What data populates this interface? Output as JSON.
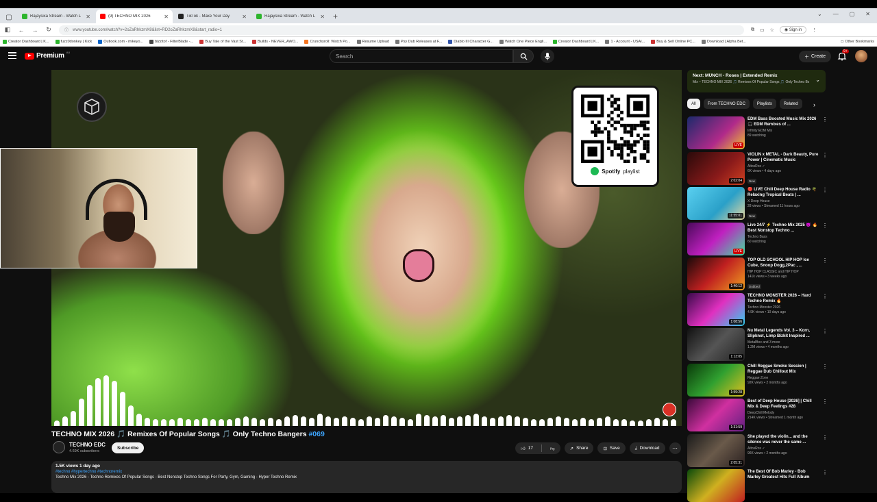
{
  "browser": {
    "tabs": [
      {
        "title": "Rajaysixa Stream - Watch L",
        "color": "#2db52d",
        "active": false
      },
      {
        "title": "(9) TECHNO MIX 2026",
        "color": "#ff0000",
        "active": true
      },
      {
        "title": "TikTok - Make Your Day",
        "color": "#222222",
        "active": false
      },
      {
        "title": "Rajaysixa Stream - Watch L",
        "color": "#2db52d",
        "active": false
      }
    ],
    "url": "www.youtube.com/watch?v=2oZaRhkzmX8&list=RD2oZaRhkzmX8&start_radio=1",
    "signin_label": "Sign in",
    "bookmarks": [
      {
        "label": "Creator Dashboard | K...",
        "color": "#2db52d"
      },
      {
        "label": "fuzz0donkey | Kick",
        "color": "#2db52d"
      },
      {
        "label": "Outlook.com - mikeyo...",
        "color": "#0a64c8"
      },
      {
        "label": "bizzitof - FilterBlade -...",
        "color": "#444444"
      },
      {
        "label": "Buy Tale of the Vast St...",
        "color": "#cc3333"
      },
      {
        "label": "Builds - NEVER_AWO...",
        "color": "#cc3333"
      },
      {
        "label": "Crunchyroll: Watch Po...",
        "color": "#f47521"
      },
      {
        "label": "Resume Upload",
        "color": "#777777"
      },
      {
        "label": "Psy Dub Releases at F...",
        "color": "#777777"
      },
      {
        "label": "Diablo III Character G...",
        "color": "#3355aa"
      },
      {
        "label": "Watch One Piece Engli...",
        "color": "#777777"
      },
      {
        "label": "Creator Dashboard | K...",
        "color": "#2db52d"
      },
      {
        "label": "1 - Account - USAI...",
        "color": "#777777"
      },
      {
        "label": "Buy & Sell Online PC...",
        "color": "#cc3333"
      },
      {
        "label": "Download | Alpha Bet...",
        "color": "#777777"
      }
    ],
    "bookmarks_other": "Other Bookmarks"
  },
  "youtube": {
    "logo_text": "Premium",
    "logo_country": "AU",
    "search_placeholder": "Search",
    "create_label": "Create",
    "notif_count": "9+",
    "video": {
      "qr_label": "playlist",
      "spotify_label": "Spotify"
    },
    "title_main": "TECHNO MIX 2026 🎵 Remixes Of Popular Songs 🎵 Only Techno Bangers ",
    "title_tag": "#069",
    "channel_name": "TECHNO EDC",
    "channel_subs": "4.69K subscribers",
    "subscribe_label": "Subscribe",
    "like_count": "17",
    "share_label": "Share",
    "save_label": "Save",
    "download_label": "Download",
    "desc_meta": "1.5K views  1 day ago",
    "desc_tags": "#techno #hypertechno #technoremix",
    "desc_text": "Techno Mix 2026 - Techno Remixes Of Popular Songs - Best Nonstop Techno Songs For Party, Gym, Gaming - Hyper Techno Remix",
    "next_title": "Next: MÜNCH - Roses | Extended Remix",
    "next_sub": "Mix – TECHNO MIX 2026 🎵 Remixes Of Popular Songs 🎵 Only Techno Bangers #069",
    "chips": [
      "All",
      "From TECHNO EDC",
      "Playlists",
      "Related"
    ],
    "recommendations": [
      {
        "title": "EDM Bass Boosted Music Mix 2026 🎧 EDM Remixes of ...",
        "channel": "Infinity EDM Mix",
        "meta": "89 watching",
        "badge": "",
        "duration": "LIVE",
        "live": true,
        "thumb": "linear-gradient(135deg,#1b2a6b,#b02a8a 60%,#f0c030)"
      },
      {
        "title": "VIOLIN x METAL - Dark Beauty, Pure Power | Cinematic Music",
        "channel": "AltosRox ✓",
        "meta": "6K views • 4 days ago",
        "badge": "New",
        "duration": "2:02:04",
        "live": false,
        "thumb": "linear-gradient(135deg,#2a0a0a,#8a1a1a 60%,#d04020)"
      },
      {
        "title": "🔴 LIVE Chill Deep House Radio 🌴 Relaxing Tropical Beats | ...",
        "channel": "X Deep House",
        "meta": "28 views • Streamed 11 hours ago",
        "badge": "New",
        "duration": "11:55:01",
        "live": false,
        "thumb": "linear-gradient(135deg,#5ad0f0,#2aa0c8 60%,#e8d8a0)"
      },
      {
        "title": "Live 24/7 ⚡ Techno Mix 2025 😈 🔥 Best Nonstop Techno ...",
        "channel": "Techno Bass",
        "meta": "60 watching",
        "badge": "",
        "duration": "LIVE",
        "live": true,
        "thumb": "linear-gradient(135deg,#4a0a5a,#c020c0 50%,#40e0a0)"
      },
      {
        "title": "TOP OLD SCHOOL HIP HOP Ice Cube, Snoop Dogg,2Pac , ...",
        "channel": "HIP HOP CLASSIC and HIP HOP",
        "meta": "141k views • 3 weeks ago",
        "badge": "Dubbed",
        "duration": "1:46:12",
        "live": false,
        "thumb": "linear-gradient(135deg,#1a0a0a,#c02020 50%,#f0a020)"
      },
      {
        "title": "TECHNO MONSTER 2026 – Hard Techno Remix 🔥",
        "channel": "Techno Monster 2026",
        "meta": "4.9K views • 10 days ago",
        "badge": "",
        "duration": "1:08:56",
        "live": false,
        "thumb": "linear-gradient(135deg,#3a0a4a,#e030c0 50%,#30d0f0)"
      },
      {
        "title": "Nu Metal Legends Vol. 3 – Korn, Slipknot, Limp Bizkit Inspired ...",
        "channel": "MetalBox and 3 more",
        "meta": "1.2M views • 4 months ago",
        "badge": "",
        "duration": "1:13:05",
        "live": false,
        "thumb": "linear-gradient(135deg,#111111,#555555 50%,#222222)"
      },
      {
        "title": "Chill Reggae Smoke Session | Reggae Dub Chillout Mix",
        "channel": "Reggae Zone",
        "meta": "92K views • 2 months ago",
        "badge": "",
        "duration": "1:59:28",
        "live": false,
        "thumb": "linear-gradient(135deg,#0a3a0a,#30a030 50%,#e0c020)"
      },
      {
        "title": "Best of Deep House [2026] | Chill Mix & Deep Feelings #28",
        "channel": "DeepChill Melody",
        "meta": "214K views • Streamed 1 month ago",
        "badge": "",
        "duration": "1:31:59",
        "live": false,
        "thumb": "linear-gradient(135deg,#3a0a3a,#d030a0 50%,#602080)"
      },
      {
        "title": "She played the violin... and the silence was never the same ...",
        "channel": "AltosRox ✓",
        "meta": "96K views • 2 months ago",
        "badge": "",
        "duration": "2:05:31",
        "live": false,
        "thumb": "linear-gradient(135deg,#1a1a1a,#6a5a4a 50%,#2a2020)"
      },
      {
        "title": "The Best Of Bob Marley - Bob Marley Greatest Hits Full Album",
        "channel": "",
        "meta": "",
        "badge": "",
        "duration": "",
        "live": false,
        "thumb": "linear-gradient(135deg,#0a4a0a,#d0b020 50%,#c02020)"
      }
    ]
  }
}
